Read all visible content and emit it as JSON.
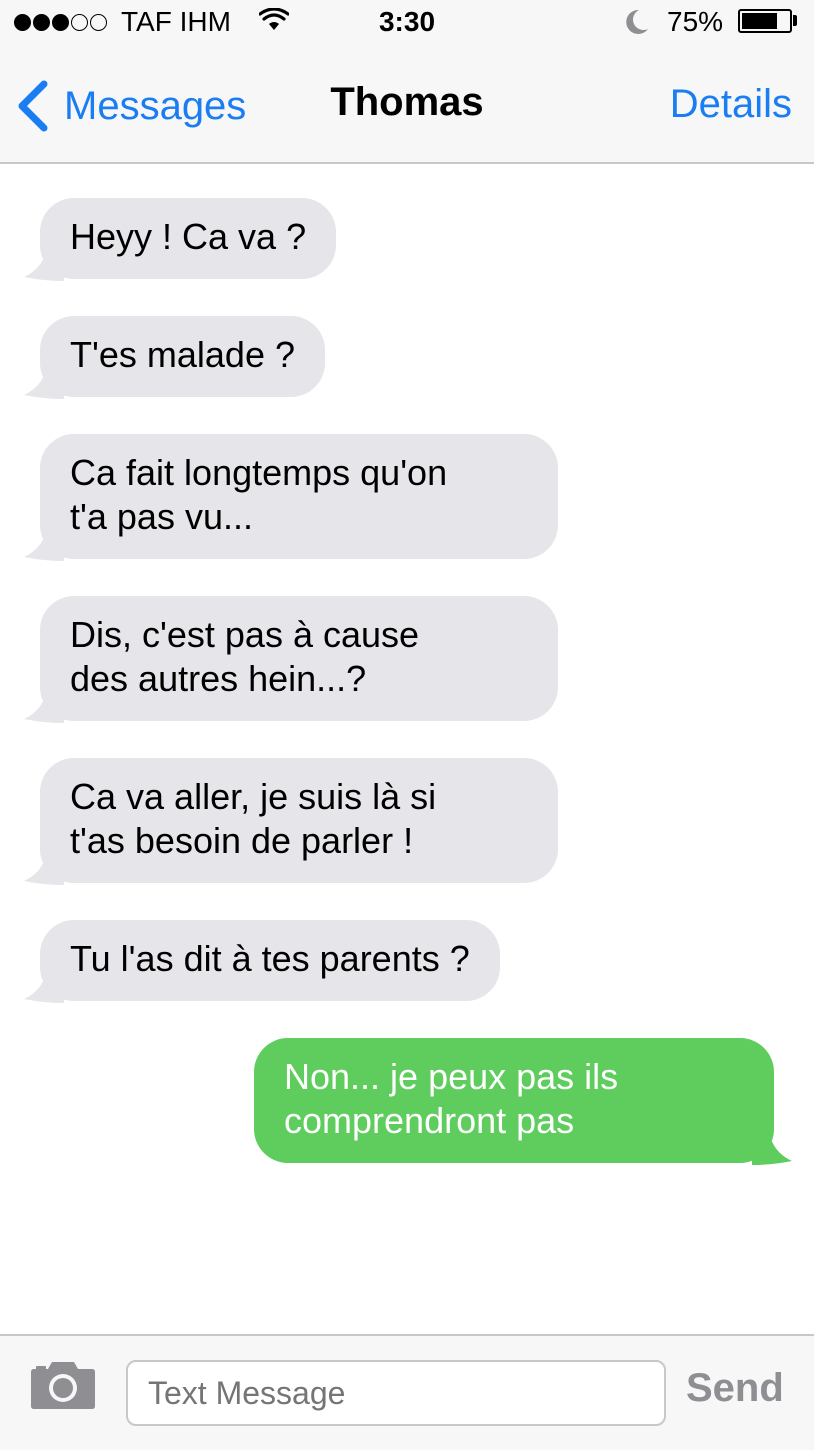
{
  "status_bar": {
    "carrier": "TAF IHM",
    "time": "3:30",
    "battery_percent": "75%",
    "battery_level": 0.75,
    "signal_bars_filled": 3,
    "signal_bars_total": 5,
    "icons": [
      "wifi-icon",
      "moon-icon",
      "battery-icon"
    ]
  },
  "nav": {
    "back_label": "Messages",
    "title": "Thomas",
    "details_label": "Details"
  },
  "messages": [
    {
      "direction": "incoming",
      "text": "Heyy ! Ca va ?"
    },
    {
      "direction": "incoming",
      "text": "T'es malade ?"
    },
    {
      "direction": "incoming",
      "lines": [
        "Ca fait longtemps qu'on",
        "t'a pas vu..."
      ]
    },
    {
      "direction": "incoming",
      "lines": [
        "Dis, c'est pas à cause",
        "des autres hein...?"
      ]
    },
    {
      "direction": "incoming",
      "lines": [
        "Ca va aller, je suis là si",
        "t'as besoin de parler !"
      ]
    },
    {
      "direction": "incoming",
      "text": "Tu l'as dit à tes parents ?"
    },
    {
      "direction": "outgoing",
      "lines": [
        "Non... je peux pas ils",
        "comprendront pas"
      ]
    }
  ],
  "input_bar": {
    "placeholder": "Text Message",
    "send_label": "Send",
    "camera_icon": "camera-icon"
  },
  "colors": {
    "accent_blue": "#1a7ef2",
    "incoming_bubble": "#e5e5ea",
    "outgoing_bubble": "#5ecd5d",
    "bar_background": "#f7f7f7"
  }
}
